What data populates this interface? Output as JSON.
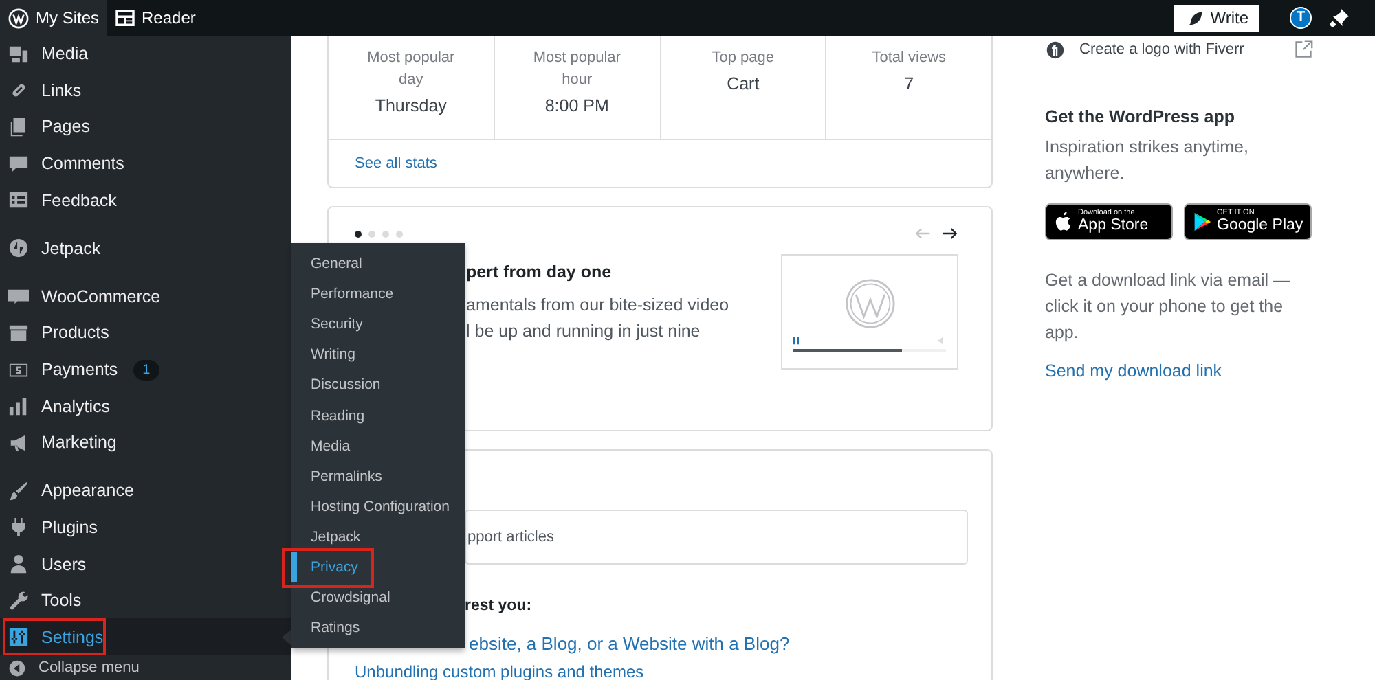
{
  "topbar": {
    "my_sites": "My Sites",
    "reader": "Reader",
    "write_button": "Write",
    "avatar_initial": "T"
  },
  "sidebar": {
    "groups": [
      {
        "items": [
          {
            "label": "Media",
            "selected": false,
            "annotated": false
          },
          {
            "label": "Links",
            "selected": false,
            "annotated": false
          },
          {
            "label": "Pages",
            "selected": false,
            "annotated": false
          },
          {
            "label": "Comments",
            "selected": false,
            "annotated": false
          },
          {
            "label": "Feedback",
            "selected": false,
            "annotated": false
          }
        ]
      },
      {
        "items": [
          {
            "label": "Jetpack",
            "selected": false,
            "annotated": false
          }
        ]
      },
      {
        "items": [
          {
            "label": "WooCommerce",
            "selected": false,
            "annotated": false
          },
          {
            "label": "Products",
            "selected": false,
            "annotated": false
          },
          {
            "label": "Payments",
            "selected": false,
            "annotated": false,
            "badge": "1"
          },
          {
            "label": "Analytics",
            "selected": false,
            "annotated": false
          },
          {
            "label": "Marketing",
            "selected": false,
            "annotated": false
          }
        ]
      },
      {
        "items": [
          {
            "label": "Appearance",
            "selected": false,
            "annotated": false
          },
          {
            "label": "Plugins",
            "selected": false,
            "annotated": false
          },
          {
            "label": "Users",
            "selected": false,
            "annotated": false
          },
          {
            "label": "Tools",
            "selected": false,
            "annotated": false
          },
          {
            "label": "Settings",
            "selected": true,
            "annotated": true
          }
        ]
      }
    ],
    "collapse": "Collapse menu"
  },
  "submenu": {
    "items": [
      {
        "label": "General",
        "selected": false,
        "annotated": false
      },
      {
        "label": "Performance",
        "selected": false,
        "annotated": false
      },
      {
        "label": "Security",
        "selected": false,
        "annotated": false
      },
      {
        "label": "Writing",
        "selected": false,
        "annotated": false
      },
      {
        "label": "Discussion",
        "selected": false,
        "annotated": false
      },
      {
        "label": "Reading",
        "selected": false,
        "annotated": false
      },
      {
        "label": "Media",
        "selected": false,
        "annotated": false
      },
      {
        "label": "Permalinks",
        "selected": false,
        "annotated": false
      },
      {
        "label": "Hosting Configuration",
        "selected": false,
        "annotated": false
      },
      {
        "label": "Jetpack",
        "selected": false,
        "annotated": false
      },
      {
        "label": "Privacy",
        "selected": true,
        "annotated": true
      },
      {
        "label": "Crowdsignal",
        "selected": false,
        "annotated": false
      },
      {
        "label": "Ratings",
        "selected": false,
        "annotated": false
      }
    ]
  },
  "stats": {
    "cells": [
      {
        "label": "Most popular day",
        "value": "Thursday"
      },
      {
        "label": "Most popular hour",
        "value": "8:00 PM"
      },
      {
        "label": "Top page",
        "value": "Cart"
      },
      {
        "label": "Total views",
        "value": "7"
      }
    ],
    "link": "See all stats"
  },
  "tour": {
    "dots": [
      {
        "selected": true
      },
      {
        "selected": false
      },
      {
        "selected": false
      },
      {
        "selected": false
      }
    ],
    "prev_disabled": true,
    "next_disabled": false,
    "title": "pert from day one",
    "body_lines": [
      "amentals from our bite-sized video",
      "l be up and running in just nine"
    ],
    "video": {
      "level": 0.71
    }
  },
  "help": {
    "search_placeholder": "pport articles",
    "heading": "rest you:",
    "links": [
      "ebsite, a Blog, or a Website with a Blog?",
      "Unbundling custom plugins and themes"
    ]
  },
  "aside": {
    "promo_link": "Create a logo with Fiverr",
    "app_title": "Get the WordPress app",
    "app_text": "Inspiration strikes anytime, anywhere.",
    "badges": [
      {
        "small": "Download on the",
        "big": "App Store"
      },
      {
        "small": "GET IT ON",
        "big": "Google Play"
      }
    ],
    "email_text": "Get a download link via email — click it on your phone to get the app.",
    "email_link": "Send my download link"
  }
}
